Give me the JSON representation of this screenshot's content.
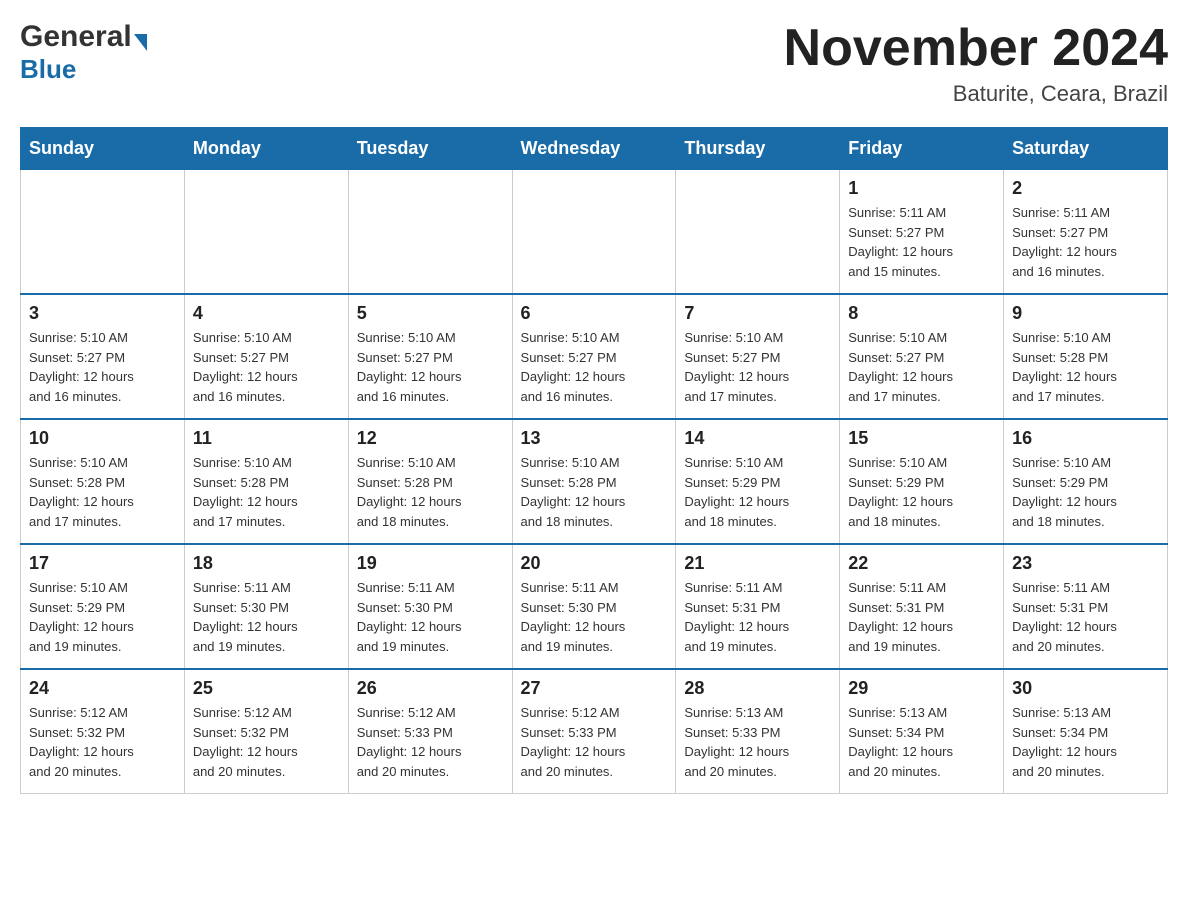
{
  "header": {
    "logo_general": "General",
    "logo_blue": "Blue",
    "month_title": "November 2024",
    "subtitle": "Baturite, Ceara, Brazil"
  },
  "calendar": {
    "days_of_week": [
      "Sunday",
      "Monday",
      "Tuesday",
      "Wednesday",
      "Thursday",
      "Friday",
      "Saturday"
    ],
    "weeks": [
      [
        {
          "day": "",
          "info": ""
        },
        {
          "day": "",
          "info": ""
        },
        {
          "day": "",
          "info": ""
        },
        {
          "day": "",
          "info": ""
        },
        {
          "day": "",
          "info": ""
        },
        {
          "day": "1",
          "info": "Sunrise: 5:11 AM\nSunset: 5:27 PM\nDaylight: 12 hours\nand 15 minutes."
        },
        {
          "day": "2",
          "info": "Sunrise: 5:11 AM\nSunset: 5:27 PM\nDaylight: 12 hours\nand 16 minutes."
        }
      ],
      [
        {
          "day": "3",
          "info": "Sunrise: 5:10 AM\nSunset: 5:27 PM\nDaylight: 12 hours\nand 16 minutes."
        },
        {
          "day": "4",
          "info": "Sunrise: 5:10 AM\nSunset: 5:27 PM\nDaylight: 12 hours\nand 16 minutes."
        },
        {
          "day": "5",
          "info": "Sunrise: 5:10 AM\nSunset: 5:27 PM\nDaylight: 12 hours\nand 16 minutes."
        },
        {
          "day": "6",
          "info": "Sunrise: 5:10 AM\nSunset: 5:27 PM\nDaylight: 12 hours\nand 16 minutes."
        },
        {
          "day": "7",
          "info": "Sunrise: 5:10 AM\nSunset: 5:27 PM\nDaylight: 12 hours\nand 17 minutes."
        },
        {
          "day": "8",
          "info": "Sunrise: 5:10 AM\nSunset: 5:27 PM\nDaylight: 12 hours\nand 17 minutes."
        },
        {
          "day": "9",
          "info": "Sunrise: 5:10 AM\nSunset: 5:28 PM\nDaylight: 12 hours\nand 17 minutes."
        }
      ],
      [
        {
          "day": "10",
          "info": "Sunrise: 5:10 AM\nSunset: 5:28 PM\nDaylight: 12 hours\nand 17 minutes."
        },
        {
          "day": "11",
          "info": "Sunrise: 5:10 AM\nSunset: 5:28 PM\nDaylight: 12 hours\nand 17 minutes."
        },
        {
          "day": "12",
          "info": "Sunrise: 5:10 AM\nSunset: 5:28 PM\nDaylight: 12 hours\nand 18 minutes."
        },
        {
          "day": "13",
          "info": "Sunrise: 5:10 AM\nSunset: 5:28 PM\nDaylight: 12 hours\nand 18 minutes."
        },
        {
          "day": "14",
          "info": "Sunrise: 5:10 AM\nSunset: 5:29 PM\nDaylight: 12 hours\nand 18 minutes."
        },
        {
          "day": "15",
          "info": "Sunrise: 5:10 AM\nSunset: 5:29 PM\nDaylight: 12 hours\nand 18 minutes."
        },
        {
          "day": "16",
          "info": "Sunrise: 5:10 AM\nSunset: 5:29 PM\nDaylight: 12 hours\nand 18 minutes."
        }
      ],
      [
        {
          "day": "17",
          "info": "Sunrise: 5:10 AM\nSunset: 5:29 PM\nDaylight: 12 hours\nand 19 minutes."
        },
        {
          "day": "18",
          "info": "Sunrise: 5:11 AM\nSunset: 5:30 PM\nDaylight: 12 hours\nand 19 minutes."
        },
        {
          "day": "19",
          "info": "Sunrise: 5:11 AM\nSunset: 5:30 PM\nDaylight: 12 hours\nand 19 minutes."
        },
        {
          "day": "20",
          "info": "Sunrise: 5:11 AM\nSunset: 5:30 PM\nDaylight: 12 hours\nand 19 minutes."
        },
        {
          "day": "21",
          "info": "Sunrise: 5:11 AM\nSunset: 5:31 PM\nDaylight: 12 hours\nand 19 minutes."
        },
        {
          "day": "22",
          "info": "Sunrise: 5:11 AM\nSunset: 5:31 PM\nDaylight: 12 hours\nand 19 minutes."
        },
        {
          "day": "23",
          "info": "Sunrise: 5:11 AM\nSunset: 5:31 PM\nDaylight: 12 hours\nand 20 minutes."
        }
      ],
      [
        {
          "day": "24",
          "info": "Sunrise: 5:12 AM\nSunset: 5:32 PM\nDaylight: 12 hours\nand 20 minutes."
        },
        {
          "day": "25",
          "info": "Sunrise: 5:12 AM\nSunset: 5:32 PM\nDaylight: 12 hours\nand 20 minutes."
        },
        {
          "day": "26",
          "info": "Sunrise: 5:12 AM\nSunset: 5:33 PM\nDaylight: 12 hours\nand 20 minutes."
        },
        {
          "day": "27",
          "info": "Sunrise: 5:12 AM\nSunset: 5:33 PM\nDaylight: 12 hours\nand 20 minutes."
        },
        {
          "day": "28",
          "info": "Sunrise: 5:13 AM\nSunset: 5:33 PM\nDaylight: 12 hours\nand 20 minutes."
        },
        {
          "day": "29",
          "info": "Sunrise: 5:13 AM\nSunset: 5:34 PM\nDaylight: 12 hours\nand 20 minutes."
        },
        {
          "day": "30",
          "info": "Sunrise: 5:13 AM\nSunset: 5:34 PM\nDaylight: 12 hours\nand 20 minutes."
        }
      ]
    ]
  }
}
